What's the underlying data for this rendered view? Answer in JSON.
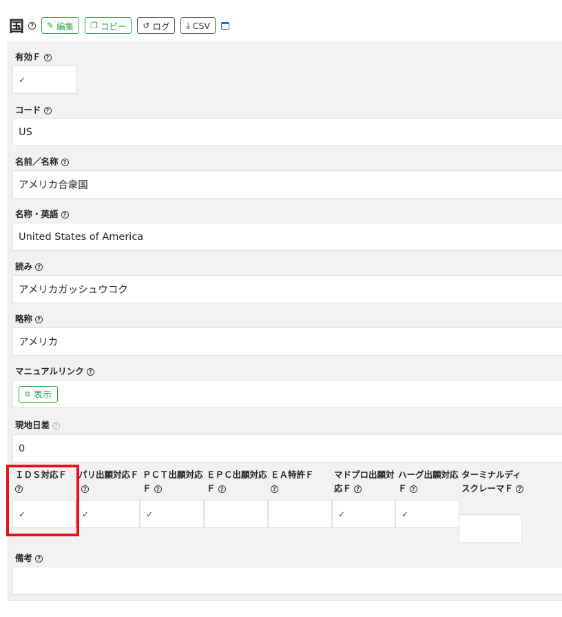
{
  "header": {
    "title": "国",
    "buttons": {
      "edit": "編集",
      "copy": "コピー",
      "log": "ログ",
      "csv": "CSV"
    }
  },
  "fields": {
    "valid_flag": {
      "label": "有効Ｆ",
      "value": "✓"
    },
    "code": {
      "label": "コード",
      "value": "US"
    },
    "name": {
      "label": "名前／名称",
      "value": "アメリカ合衆国"
    },
    "name_en": {
      "label": "名称・英語",
      "value": "United States of America"
    },
    "reading": {
      "label": "読み",
      "value": "アメリカガッシュウコク"
    },
    "short_name": {
      "label": "略称",
      "value": "アメリカ"
    },
    "manual_link": {
      "label": "マニュアルリンク",
      "button": "表示"
    },
    "time_diff": {
      "label": "現地日差",
      "value": "0"
    },
    "remarks": {
      "label": "備考",
      "value": ""
    }
  },
  "flags": [
    {
      "label": "ＩＤＳ対応Ｆ",
      "value": "✓"
    },
    {
      "label": "パリ出願対応Ｆ",
      "value": "✓"
    },
    {
      "label": "ＰＣＴ出願対応Ｆ",
      "value": "✓"
    },
    {
      "label": "ＥＰＣ出願対応Ｆ",
      "value": ""
    },
    {
      "label": "ＥＡ特許Ｆ",
      "value": ""
    },
    {
      "label": "マドプロ出願対応Ｆ",
      "value": "✓"
    },
    {
      "label": "ハーグ出願対応Ｆ",
      "value": "✓"
    },
    {
      "label": "ターミナルディスクレーマＦ",
      "value": ""
    }
  ],
  "help_symbol": "?"
}
